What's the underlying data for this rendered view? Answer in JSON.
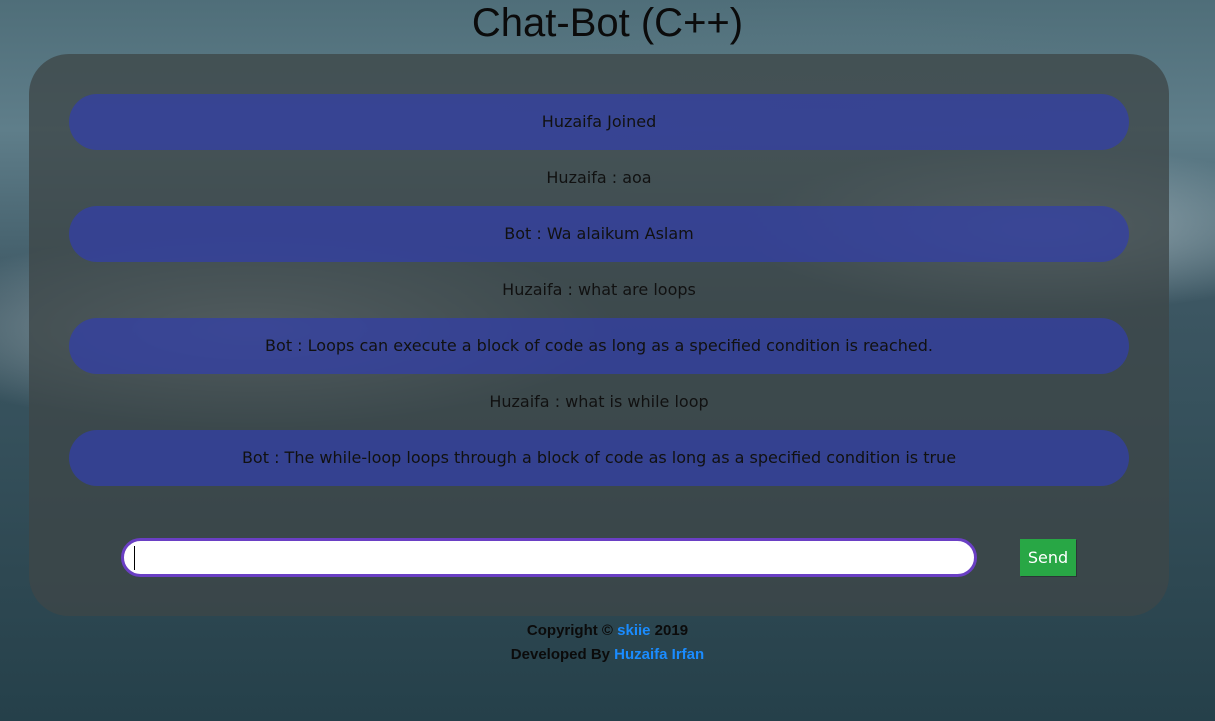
{
  "page": {
    "title": "Chat-Bot (C++)"
  },
  "chat": {
    "messages": [
      {
        "kind": "system",
        "text": "Huzaifa Joined"
      },
      {
        "kind": "user",
        "text": "Huzaifa : aoa"
      },
      {
        "kind": "bot",
        "text": "Bot : Wa alaikum Aslam"
      },
      {
        "kind": "user",
        "text": "Huzaifa : what are loops"
      },
      {
        "kind": "bot",
        "text": "Bot : Loops can execute a block of code as long as a specified condition is reached."
      },
      {
        "kind": "user",
        "text": "Huzaifa : what is while loop"
      },
      {
        "kind": "bot",
        "text": "Bot : The while-loop loops through a block of code as long as a specified condition is true"
      }
    ],
    "input_value": "",
    "send_label": "Send"
  },
  "footer": {
    "copyright_prefix": "Copyright © ",
    "copyright_link": "skiie",
    "copyright_year": " 2019",
    "developed_prefix": "Developed By ",
    "developer_link": "Huzaifa Irfan"
  },
  "colors": {
    "bot_bubble": "#3a45a8",
    "input_border": "#6a3fc4",
    "send_button": "#28a745",
    "link": "#1a8cff"
  }
}
